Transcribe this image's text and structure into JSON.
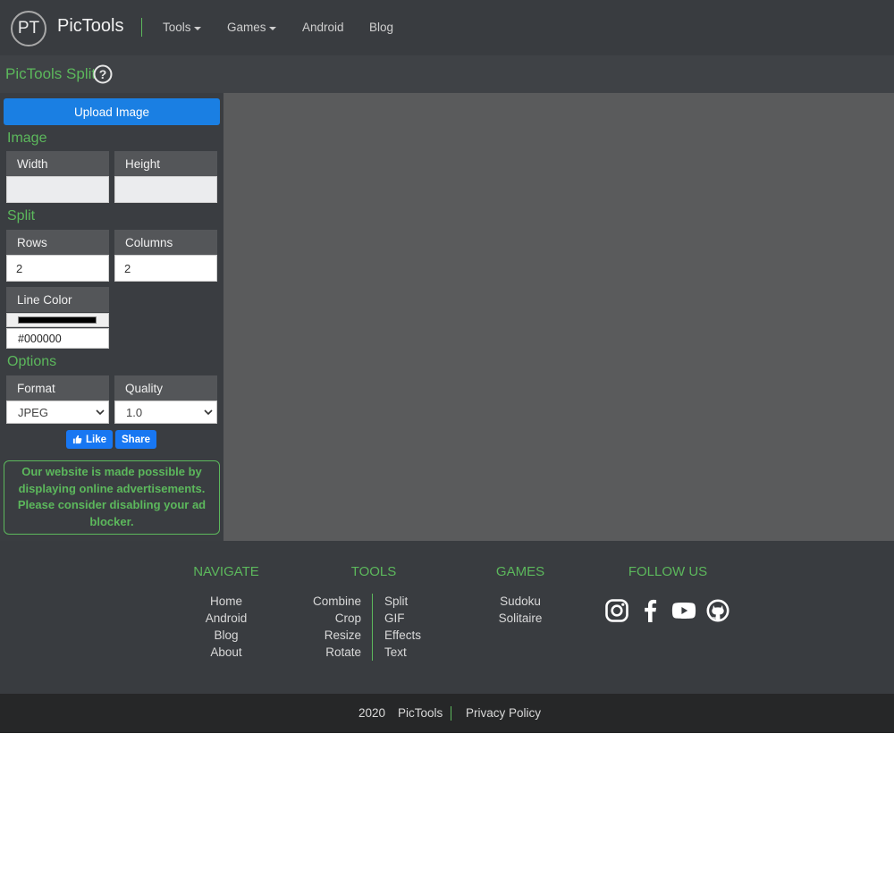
{
  "header": {
    "logo_text": "PT",
    "brand": "PicTools",
    "nav": {
      "tools": "Tools",
      "games": "Games",
      "android": "Android",
      "blog": "Blog"
    }
  },
  "page": {
    "title": "PicTools Split"
  },
  "sidebar": {
    "upload_label": "Upload Image",
    "image_section": "Image",
    "width_label": "Width",
    "width_value": "",
    "height_label": "Height",
    "height_value": "",
    "split_section": "Split",
    "rows_label": "Rows",
    "rows_value": "2",
    "columns_label": "Columns",
    "columns_value": "2",
    "line_color_label": "Line Color",
    "line_color_hex": "#000000",
    "options_section": "Options",
    "format_label": "Format",
    "format_selected": "JPEG",
    "quality_label": "Quality",
    "quality_selected": "1.0",
    "like_label": "Like",
    "share_label": "Share",
    "ad_notice": "Our website is made possible by displaying online advertisements. Please consider disabling your ad blocker."
  },
  "footer": {
    "navigate_heading": "NAVIGATE",
    "navigate_links": [
      "Home",
      "Android",
      "Blog",
      "About"
    ],
    "tools_heading": "TOOLS",
    "tools_left": [
      "Combine",
      "Crop",
      "Resize",
      "Rotate"
    ],
    "tools_right": [
      "Split",
      "GIF",
      "Effects",
      "Text"
    ],
    "games_heading": "GAMES",
    "games_links": [
      "Sudoku",
      "Solitaire"
    ],
    "follow_heading": "FOLLOW US",
    "social_icons": [
      "instagram-icon",
      "facebook-icon",
      "youtube-icon",
      "github-icon"
    ]
  },
  "bottom": {
    "year": "2020",
    "brand": "PicTools",
    "privacy": "Privacy Policy"
  },
  "colors": {
    "accent_green": "#5cb85c",
    "primary_blue": "#1a7fe3",
    "facebook_blue": "#1877f2",
    "dark_bg": "#393c40",
    "canvas_bg": "#5a5b5c",
    "line_color": "#000000"
  }
}
